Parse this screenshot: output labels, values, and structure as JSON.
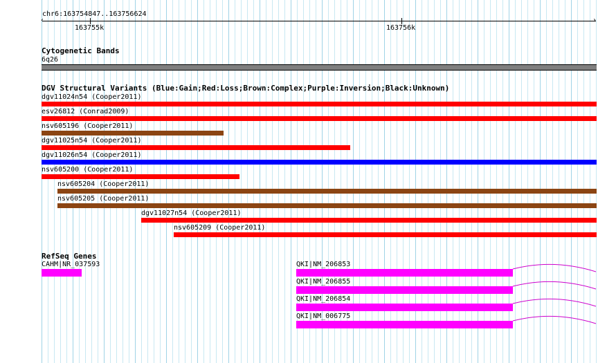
{
  "ruler": {
    "range_label": "chr6:163754847..163756624",
    "major_ticks": [
      "163755k",
      "163756k"
    ]
  },
  "cytoband_track": {
    "title": "Cytogenetic Bands",
    "band_label": "6q26",
    "band_color": "#7f7f7f"
  },
  "dgv_track": {
    "title": "DGV Structural Variants (Blue:Gain;Red:Loss;Brown:Complex;Purple:Inversion;Black:Unknown)",
    "colors": {
      "loss": "#ff0000",
      "gain": "#0000ff",
      "complex": "#8b4513",
      "inversion": "#800080",
      "unknown": "#000000"
    },
    "variants": [
      {
        "label": "dgv11024n54 (Cooper2011)",
        "type": "loss"
      },
      {
        "label": "esv26812 (Conrad2009)",
        "type": "loss"
      },
      {
        "label": "nsv605196 (Cooper2011)",
        "type": "complex"
      },
      {
        "label": "dgv11025n54 (Cooper2011)",
        "type": "loss"
      },
      {
        "label": "dgv11026n54 (Cooper2011)",
        "type": "gain"
      },
      {
        "label": "nsv605200 (Cooper2011)",
        "type": "loss"
      },
      {
        "label": "nsv605204 (Cooper2011)",
        "type": "complex"
      },
      {
        "label": "nsv605205 (Cooper2011)",
        "type": "complex"
      },
      {
        "label": "dgv11027n54 (Cooper2011)",
        "type": "loss"
      },
      {
        "label": "nsv605209 (Cooper2011)",
        "type": "loss"
      }
    ]
  },
  "refseq_track": {
    "title": "RefSeq Genes",
    "exon_color": "#ff00ff",
    "intron_color": "#cc00cc",
    "genes": [
      {
        "label": "CAHM|NR_037593"
      },
      {
        "label": "QKI|NM_206853"
      },
      {
        "label": "QKI|NM_206855"
      },
      {
        "label": "QKI|NM_206854"
      },
      {
        "label": "QKI|NM_006775"
      }
    ]
  }
}
